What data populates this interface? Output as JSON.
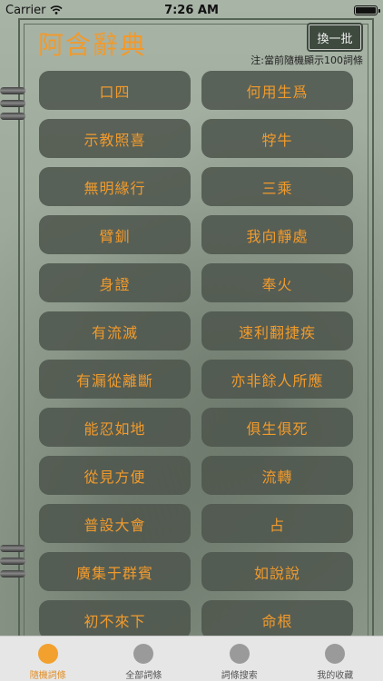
{
  "status": {
    "carrier": "Carrier",
    "time": "7:26 AM"
  },
  "header": {
    "title": "阿含辭典",
    "refresh_label": "換一批",
    "note": "注:當前隨機顯示100詞條"
  },
  "terms": [
    "口四",
    "何用生爲",
    "示教照喜",
    "牸牛",
    "無明緣行",
    "三乘",
    "臂釧",
    "我向靜處",
    "身證",
    "奉火",
    "有流滅",
    "速利翻捷疾",
    "有漏從離斷",
    "亦非餘人所應",
    "能忍如地",
    "俱生俱死",
    "從見方便",
    "流轉",
    "普設大會",
    "占",
    "廣集于群賓",
    "如說說",
    "初不來下",
    "命根"
  ],
  "tabs": [
    {
      "label": "隨機詞條",
      "active": true
    },
    {
      "label": "全部詞條",
      "active": false
    },
    {
      "label": "詞條搜索",
      "active": false
    },
    {
      "label": "我的收藏",
      "active": false
    }
  ],
  "colors": {
    "accent": "#f19a2c",
    "tile": "#4e564d",
    "tab_active": "#f2a02e"
  }
}
